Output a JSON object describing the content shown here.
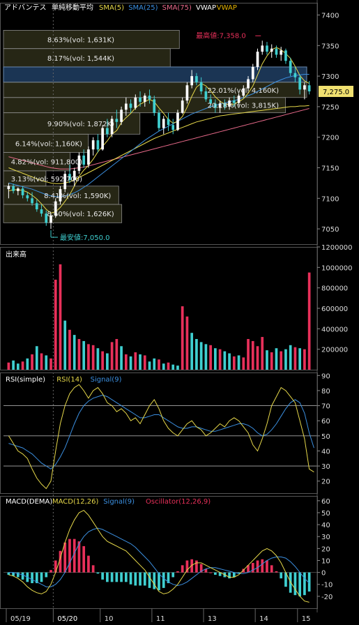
{
  "legend": {
    "main": [
      {
        "text": "アドバンテス",
        "color": "#ffffff"
      },
      {
        "text": "単純移動平均",
        "color": "#ffffff"
      },
      {
        "text": "SMA(5)",
        "color": "#e6d84a"
      },
      {
        "text": "SMA(25)",
        "color": "#3b8fe0"
      },
      {
        "text": "SMA(75)",
        "color": "#e86a8a"
      },
      {
        "text": "VWAP",
        "color": "#ffffff"
      },
      {
        "text": "VWAP",
        "color": "#e6b400"
      }
    ],
    "volume": [
      {
        "text": "出来高",
        "color": "#ffffff"
      }
    ],
    "rsi": [
      {
        "text": "RSI(simple)",
        "color": "#ffffff"
      },
      {
        "text": "RSI(14)",
        "color": "#e6d84a"
      },
      {
        "text": "Signal(9)",
        "color": "#3b8fe0"
      }
    ],
    "macd": [
      {
        "text": "MACD(DEMA)",
        "color": "#ffffff"
      },
      {
        "text": "MACD(12,26)",
        "color": "#e6d84a"
      },
      {
        "text": "Signal(9)",
        "color": "#3b8fe0"
      },
      {
        "text": "Oscillator(12,26,9)",
        "color": "#e8305a"
      }
    ]
  },
  "annotations": {
    "high": "最高値:7,358.0",
    "low": "最安値:7,050.0",
    "current_price": "7,275.0"
  },
  "x_labels": [
    "05/19",
    "05/20",
    "10",
    "11",
    "13",
    "14",
    "15"
  ],
  "colors": {
    "up": "#ffffff",
    "down": "#3fcfd0",
    "vol_up": "#e8305a",
    "vol_down": "#3fcfd0",
    "sma5": "#e6d84a",
    "sma25": "#3b8fe0",
    "sma75": "#e86a8a",
    "vwap": "#e6d84a",
    "rsi": "#e6d84a",
    "rsi_signal": "#3b8fe0",
    "macd": "#e6d84a",
    "macd_signal": "#3b8fe0",
    "osc_pos": "#e8305a",
    "osc_neg": "#3fcfd0"
  },
  "chart_data": [
    {
      "type": "candlestick",
      "ylim": [
        7025,
        7420
      ],
      "yticks": [
        7050,
        7100,
        7150,
        7200,
        7250,
        7300,
        7350,
        7400
      ],
      "volume_profile": [
        {
          "label": "8.63%(vol: 1,631K)",
          "low": 7345,
          "high": 7375,
          "rel": 0.58
        },
        {
          "label": "8.17%(vol: 1,544K)",
          "low": 7315,
          "high": 7345,
          "rel": 0.55
        },
        {
          "label": "",
          "low": 7290,
          "high": 7315,
          "rel": 1.0,
          "highlight": true
        },
        {
          "label": "22.01%(vol: 4,160K)",
          "low": 7265,
          "high": 7290,
          "rel": 1.0
        },
        {
          "label": "20.18%(vol: 3,815K)",
          "low": 7240,
          "high": 7265,
          "rel": 0.93
        },
        {
          "label": "9.90%(vol: 1,872K)",
          "low": 7205,
          "high": 7240,
          "rel": 0.45
        },
        {
          "label": "6.14%(vol: 1,160K)",
          "low": 7175,
          "high": 7205,
          "rel": 0.28
        },
        {
          "label": "4.82%(vol: 911,800)",
          "low": 7145,
          "high": 7175,
          "rel": 0.22
        },
        {
          "label": "3.13%(vol: 592,700)",
          "low": 7120,
          "high": 7145,
          "rel": 0.14
        },
        {
          "label": "8.41%(vol: 1,590K)",
          "low": 7090,
          "high": 7120,
          "rel": 0.38
        },
        {
          "label": "8.60%(vol: 1,626K)",
          "low": 7060,
          "high": 7090,
          "rel": 0.39
        }
      ],
      "candles": [
        [
          7115,
          7125,
          7100,
          7120
        ],
        [
          7120,
          7124,
          7108,
          7112
        ],
        [
          7112,
          7118,
          7105,
          7116
        ],
        [
          7116,
          7120,
          7100,
          7105
        ],
        [
          7105,
          7110,
          7095,
          7100
        ],
        [
          7100,
          7110,
          7088,
          7092
        ],
        [
          7092,
          7098,
          7078,
          7082
        ],
        [
          7082,
          7090,
          7070,
          7075
        ],
        [
          7075,
          7080,
          7055,
          7060
        ],
        [
          7060,
          7075,
          7050,
          7072
        ],
        [
          7072,
          7100,
          7068,
          7095
        ],
        [
          7095,
          7120,
          7090,
          7115
        ],
        [
          7115,
          7145,
          7110,
          7140
        ],
        [
          7140,
          7155,
          7125,
          7130
        ],
        [
          7130,
          7150,
          7120,
          7145
        ],
        [
          7145,
          7175,
          7140,
          7170
        ],
        [
          7170,
          7180,
          7150,
          7155
        ],
        [
          7155,
          7185,
          7150,
          7180
        ],
        [
          7180,
          7200,
          7170,
          7195
        ],
        [
          7195,
          7205,
          7175,
          7180
        ],
        [
          7180,
          7220,
          7178,
          7215
        ],
        [
          7215,
          7230,
          7200,
          7205
        ],
        [
          7205,
          7235,
          7200,
          7230
        ],
        [
          7230,
          7245,
          7215,
          7225
        ],
        [
          7225,
          7250,
          7220,
          7245
        ],
        [
          7245,
          7265,
          7235,
          7255
        ],
        [
          7255,
          7262,
          7240,
          7248
        ],
        [
          7248,
          7270,
          7245,
          7265
        ],
        [
          7265,
          7275,
          7250,
          7258
        ],
        [
          7258,
          7272,
          7250,
          7268
        ],
        [
          7268,
          7278,
          7255,
          7262
        ],
        [
          7262,
          7268,
          7235,
          7240
        ],
        [
          7240,
          7245,
          7210,
          7215
        ],
        [
          7215,
          7235,
          7205,
          7230
        ],
        [
          7230,
          7240,
          7210,
          7220
        ],
        [
          7220,
          7230,
          7205,
          7212
        ],
        [
          7212,
          7245,
          7210,
          7240
        ],
        [
          7240,
          7265,
          7238,
          7260
        ],
        [
          7260,
          7290,
          7255,
          7285
        ],
        [
          7285,
          7310,
          7280,
          7300
        ],
        [
          7300,
          7305,
          7285,
          7290
        ],
        [
          7290,
          7298,
          7270,
          7275
        ],
        [
          7275,
          7282,
          7258,
          7262
        ],
        [
          7262,
          7270,
          7248,
          7255
        ],
        [
          7255,
          7262,
          7240,
          7248
        ],
        [
          7248,
          7260,
          7240,
          7255
        ],
        [
          7255,
          7262,
          7245,
          7250
        ],
        [
          7250,
          7265,
          7245,
          7260
        ],
        [
          7260,
          7268,
          7250,
          7256
        ],
        [
          7256,
          7272,
          7252,
          7268
        ],
        [
          7268,
          7285,
          7265,
          7280
        ],
        [
          7280,
          7300,
          7275,
          7295
        ],
        [
          7295,
          7320,
          7290,
          7315
        ],
        [
          7315,
          7345,
          7310,
          7340
        ],
        [
          7340,
          7358,
          7335,
          7350
        ],
        [
          7350,
          7356,
          7335,
          7340
        ],
        [
          7340,
          7352,
          7330,
          7345
        ],
        [
          7345,
          7350,
          7330,
          7335
        ],
        [
          7335,
          7348,
          7325,
          7342
        ],
        [
          7342,
          7345,
          7320,
          7325
        ],
        [
          7325,
          7330,
          7300,
          7305
        ],
        [
          7305,
          7315,
          7290,
          7298
        ],
        [
          7298,
          7302,
          7270,
          7278
        ],
        [
          7278,
          7290,
          7262,
          7285
        ],
        [
          7285,
          7292,
          7270,
          7275
        ]
      ],
      "sma5": [
        7112,
        7114,
        7114,
        7113,
        7110,
        7105,
        7099,
        7091,
        7082,
        7076,
        7078,
        7085,
        7095,
        7106,
        7120,
        7136,
        7146,
        7154,
        7164,
        7176,
        7185,
        7194,
        7205,
        7211,
        7224,
        7232,
        7239,
        7248,
        7254,
        7258,
        7262,
        7258,
        7248,
        7239,
        7229,
        7223,
        7226,
        7234,
        7249,
        7267,
        7282,
        7288,
        7284,
        7276,
        7266,
        7259,
        7254,
        7254,
        7254,
        7258,
        7263,
        7272,
        7284,
        7302,
        7320,
        7333,
        7343,
        7347,
        7343,
        7337,
        7329,
        7316,
        7301,
        7292,
        7288
      ],
      "sma25": [
        7125,
        7123,
        7121,
        7119,
        7117,
        7115,
        7112,
        7109,
        7106,
        7104,
        7103,
        7103,
        7104,
        7106,
        7109,
        7113,
        7118,
        7123,
        7129,
        7135,
        7141,
        7147,
        7153,
        7159,
        7165,
        7171,
        7177,
        7183,
        7189,
        7195,
        7200,
        7205,
        7210,
        7214,
        7218,
        7222,
        7226,
        7230,
        7234,
        7238,
        7241,
        7244,
        7247,
        7250,
        7252,
        7254,
        7256,
        7258,
        7260,
        7262,
        7265,
        7268,
        7271,
        7275,
        7279,
        7283,
        7287,
        7291,
        7294,
        7297,
        7299,
        7301,
        7302,
        7303,
        7303
      ],
      "sma75": [
        7168,
        7166,
        7164,
        7162,
        7160,
        7158,
        7156,
        7154,
        7152,
        7150,
        7149,
        7148,
        7148,
        7148,
        7149,
        7150,
        7151,
        7153,
        7155,
        7157,
        7159,
        7161,
        7163,
        7165,
        7167,
        7169,
        7171,
        7173,
        7175,
        7177,
        7179,
        7181,
        7183,
        7185,
        7187,
        7189,
        7191,
        7193,
        7195,
        7197,
        7199,
        7201,
        7203,
        7205,
        7207,
        7209,
        7211,
        7213,
        7215,
        7217,
        7219,
        7221,
        7223,
        7225,
        7227,
        7229,
        7231,
        7233,
        7235,
        7237,
        7239,
        7241,
        7243,
        7245,
        7247
      ],
      "vwap": [
        7150,
        7147,
        7144,
        7141,
        7138,
        7135,
        7132,
        7129,
        7127,
        7125,
        7124,
        7124,
        7125,
        7127,
        7130,
        7134,
        7138,
        7142,
        7146,
        7150,
        7154,
        7158,
        7162,
        7166,
        7170,
        7174,
        7178,
        7182,
        7186,
        7190,
        7194,
        7198,
        7201,
        7204,
        7207,
        7210,
        7213,
        7216,
        7219,
        7222,
        7225,
        7227,
        7229,
        7231,
        7233,
        7235,
        7236,
        7237,
        7238,
        7239,
        7240,
        7241,
        7242,
        7243,
        7244,
        7245,
        7246,
        7247,
        7248,
        7249,
        7250,
        7250,
        7251,
        7251,
        7252
      ]
    },
    {
      "type": "bar",
      "title": "出来高",
      "ylim": [
        0,
        1200000
      ],
      "yticks": [
        200000,
        400000,
        600000,
        800000,
        1000000,
        1200000
      ],
      "values": [
        70000,
        90000,
        60000,
        80000,
        110000,
        150000,
        230000,
        160000,
        140000,
        110000,
        880000,
        1030000,
        480000,
        390000,
        340000,
        300000,
        280000,
        250000,
        240000,
        210000,
        180000,
        160000,
        270000,
        300000,
        230000,
        150000,
        130000,
        170000,
        150000,
        140000,
        80000,
        110000,
        100000,
        60000,
        70000,
        50000,
        40000,
        620000,
        520000,
        360000,
        300000,
        270000,
        250000,
        240000,
        210000,
        200000,
        180000,
        160000,
        130000,
        140000,
        120000,
        300000,
        280000,
        230000,
        320000,
        190000,
        170000,
        210000,
        180000,
        200000,
        240000,
        220000,
        210000,
        200000,
        950000
      ],
      "up": [
        1,
        0,
        0,
        1,
        0,
        1,
        0,
        1,
        0,
        1,
        1,
        1,
        0,
        1,
        0,
        1,
        0,
        1,
        1,
        0,
        1,
        0,
        1,
        1,
        0,
        1,
        0,
        1,
        0,
        1,
        0,
        0,
        1,
        0,
        1,
        0,
        0,
        1,
        1,
        0,
        0,
        0,
        0,
        1,
        0,
        1,
        0,
        0,
        1,
        0,
        1,
        1,
        1,
        1,
        1,
        0,
        1,
        0,
        1,
        0,
        0,
        1,
        0,
        1,
        1
      ]
    },
    {
      "type": "line",
      "title": "RSI(simple)",
      "ylim": [
        12,
        92
      ],
      "yticks": [
        20,
        30,
        40,
        50,
        60,
        70,
        80,
        90
      ],
      "hlines": [
        70,
        50,
        30
      ],
      "rsi": [
        50,
        45,
        40,
        38,
        35,
        28,
        22,
        18,
        15,
        20,
        40,
        58,
        70,
        78,
        82,
        84,
        80,
        75,
        80,
        82,
        78,
        72,
        70,
        66,
        68,
        65,
        60,
        62,
        58,
        64,
        70,
        74,
        68,
        60,
        55,
        52,
        50,
        54,
        58,
        60,
        56,
        54,
        50,
        52,
        55,
        58,
        56,
        60,
        62,
        60,
        56,
        52,
        44,
        40,
        48,
        58,
        70,
        76,
        82,
        80,
        76,
        72,
        60,
        48,
        28,
        26
      ],
      "signal": [
        45,
        44,
        43,
        42,
        40,
        38,
        35,
        32,
        30,
        28,
        31,
        36,
        42,
        50,
        58,
        65,
        70,
        73,
        75,
        76,
        77,
        76,
        74,
        72,
        70,
        68,
        66,
        64,
        62,
        62,
        63,
        64,
        64,
        62,
        60,
        58,
        56,
        55,
        55,
        56,
        56,
        55,
        54,
        53,
        53,
        54,
        55,
        56,
        57,
        58,
        58,
        57,
        55,
        52,
        50,
        51,
        54,
        58,
        63,
        68,
        72,
        74,
        72,
        65,
        52,
        42
      ]
    },
    {
      "type": "line",
      "title": "MACD(DEMA)",
      "ylim": [
        -30,
        64
      ],
      "yticks": [
        -20,
        -10,
        0,
        10,
        20,
        30,
        40,
        50,
        60
      ],
      "macd": [
        -2,
        -3,
        -5,
        -8,
        -12,
        -15,
        -17,
        -18,
        -16,
        -10,
        0,
        12,
        25,
        36,
        44,
        50,
        52,
        48,
        42,
        36,
        30,
        26,
        24,
        22,
        20,
        18,
        14,
        10,
        6,
        2,
        -4,
        -10,
        -16,
        -18,
        -17,
        -14,
        -10,
        -4,
        2,
        6,
        8,
        8,
        6,
        4,
        2,
        0,
        -2,
        -4,
        -4,
        -2,
        2,
        6,
        10,
        14,
        18,
        20,
        18,
        14,
        8,
        0,
        -8,
        -14,
        -20,
        -24,
        -25
      ],
      "signal": [
        0,
        0,
        -1,
        -2,
        -4,
        -6,
        -8,
        -10,
        -12,
        -12,
        -10,
        -6,
        0,
        8,
        16,
        24,
        30,
        34,
        36,
        37,
        36,
        34,
        32,
        30,
        28,
        26,
        24,
        21,
        17,
        13,
        9,
        4,
        -1,
        -5,
        -8,
        -10,
        -11,
        -10,
        -8,
        -5,
        -2,
        1,
        3,
        4,
        4,
        3,
        2,
        1,
        0,
        -1,
        -1,
        0,
        2,
        4,
        7,
        10,
        12,
        13,
        13,
        12,
        9,
        5,
        0,
        -5,
        -9
      ],
      "oscillator": [
        -2,
        -3,
        -4,
        -6,
        -8,
        -9,
        -9,
        -8,
        -4,
        2,
        10,
        18,
        25,
        28,
        28,
        26,
        22,
        14,
        6,
        -1,
        -6,
        -8,
        -8,
        -8,
        -8,
        -8,
        -10,
        -11,
        -11,
        -11,
        -13,
        -14,
        -15,
        -13,
        -9,
        -4,
        1,
        6,
        10,
        11,
        10,
        7,
        3,
        0,
        -2,
        -3,
        -4,
        -5,
        -4,
        -1,
        3,
        6,
        8,
        10,
        11,
        10,
        6,
        1,
        -5,
        -12,
        -17,
        -19,
        -20,
        -19,
        -16
      ]
    }
  ]
}
